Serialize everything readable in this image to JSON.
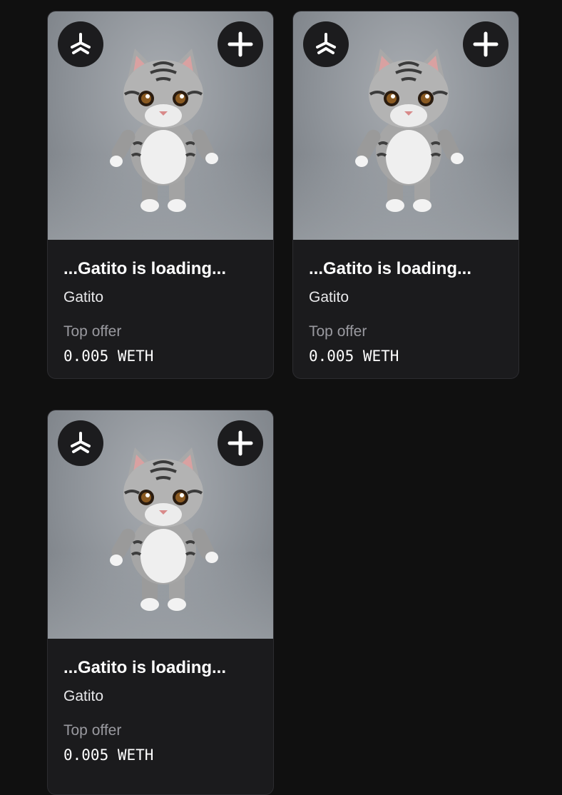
{
  "cards": [
    {
      "title": "...Gatito is loading...",
      "collection": "Gatito",
      "offer_label": "Top offer",
      "offer_value": "0.005 WETH",
      "icons": {
        "logo": "marketplace-logo-icon",
        "add": "plus-icon"
      }
    },
    {
      "title": "...Gatito is loading...",
      "collection": "Gatito",
      "offer_label": "Top offer",
      "offer_value": "0.005 WETH",
      "icons": {
        "logo": "marketplace-logo-icon",
        "add": "plus-icon"
      }
    },
    {
      "title": "...Gatito is loading...",
      "collection": "Gatito",
      "offer_label": "Top offer",
      "offer_value": "0.005 WETH",
      "icons": {
        "logo": "marketplace-logo-icon",
        "add": "plus-icon"
      }
    }
  ],
  "colors": {
    "background": "#101010",
    "card": "#1b1b1d",
    "muted_text": "#9a9aa0"
  }
}
